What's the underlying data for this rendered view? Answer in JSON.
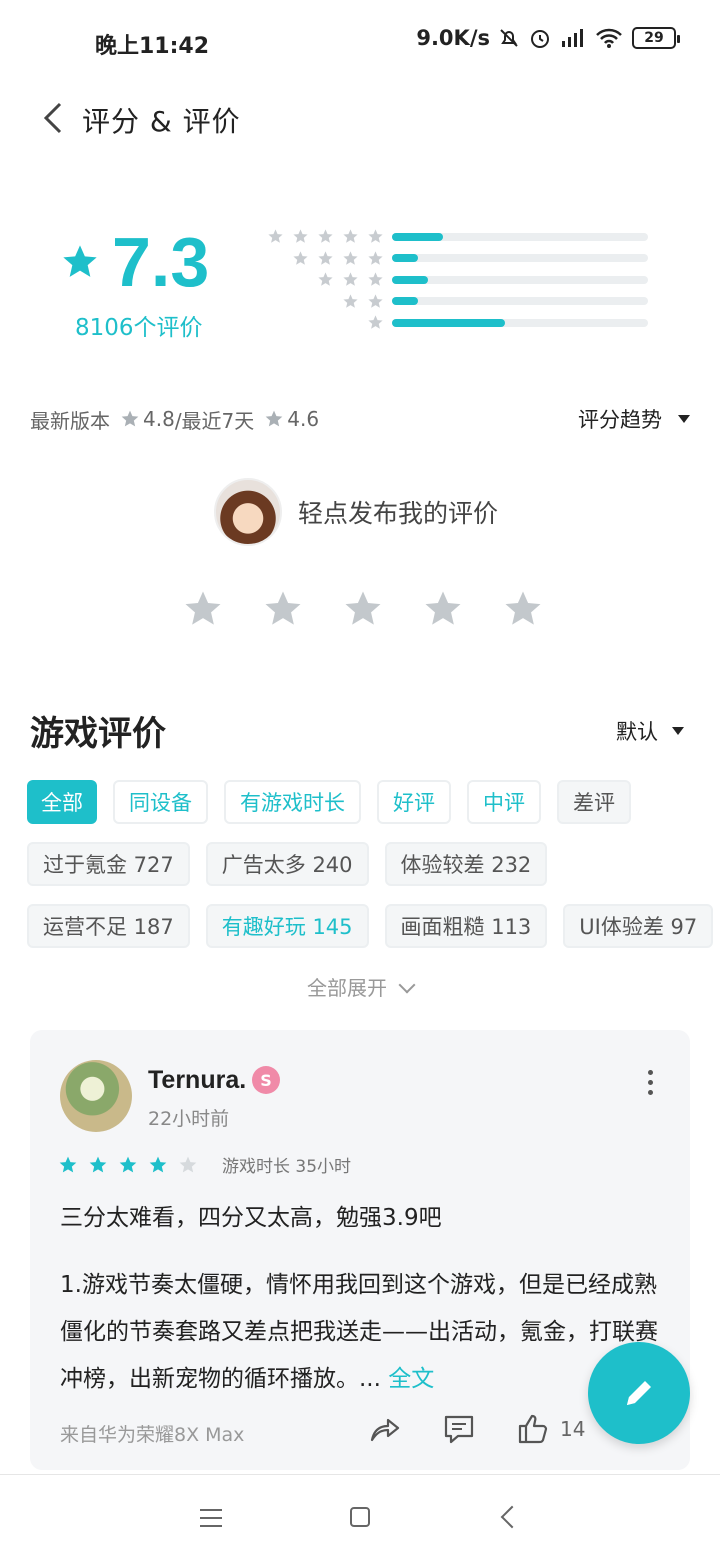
{
  "status_bar": {
    "time": "晚上11:42",
    "network_speed": "9.0K/s",
    "battery": "29"
  },
  "header": {
    "title": "评分 & 评价"
  },
  "rating": {
    "score": "7.3",
    "count_label": "8106个评价",
    "distribution": [
      {
        "stars": 5,
        "fraction": 0.2
      },
      {
        "stars": 4,
        "fraction": 0.1
      },
      {
        "stars": 3,
        "fraction": 0.14
      },
      {
        "stars": 2,
        "fraction": 0.1
      },
      {
        "stars": 1,
        "fraction": 0.44
      }
    ],
    "latest_version_label": "最新版本",
    "latest_version_score": "4.8",
    "recent_label": "/最近7天",
    "recent_score": "4.6",
    "trend_label": "评分趋势"
  },
  "my_review": {
    "prompt": "轻点发布我的评价"
  },
  "reviews_section": {
    "title": "游戏评价",
    "sort_label": "默认",
    "tags_row1": [
      "全部",
      "同设备",
      "有游戏时长",
      "好评",
      "中评",
      "差评"
    ],
    "tags_row2": [
      "过于氪金 727",
      "广告太多 240",
      "体验较差 232"
    ],
    "tags_row3": [
      "运营不足 187",
      "有趣好玩 145",
      "画面粗糙 113",
      "UI体验差 97"
    ],
    "expand_label": "全部展开"
  },
  "review": {
    "username": "Ternura.",
    "time_ago": "22小时前",
    "stars": 4,
    "playtime": "游戏时长 35小时",
    "title": "三分太难看，四分又太高，勉强3.9吧",
    "body": "1.游戏节奏太僵硬，情怀用我回到这个游戏，但是已经成熟僵化的节奏套路又差点把我送走——出活动，氪金，打联赛冲榜，出新宠物的循环播放。... ",
    "full_text_label": "全文",
    "device": "来自华为荣耀8X Max",
    "likes": "14"
  },
  "colors": {
    "accent": "#1ebfca",
    "star_gray": "#c8ccd0"
  }
}
